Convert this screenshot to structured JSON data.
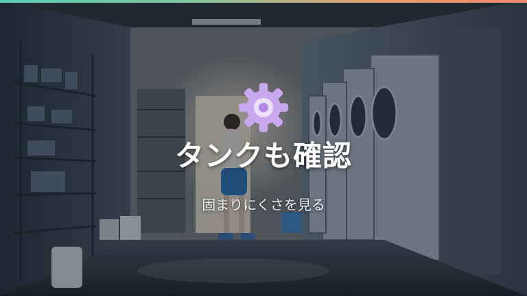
{
  "slide": {
    "title": "タンクも確認",
    "subtitle": "固まりにくさを見る"
  },
  "icons": {
    "main": "gear-icon"
  },
  "colors": {
    "gear_fill": "#c9a8f0",
    "gear_hub": "#ece2fb",
    "accent_start": "#5ad0b5",
    "accent_end": "#f08a6a"
  }
}
